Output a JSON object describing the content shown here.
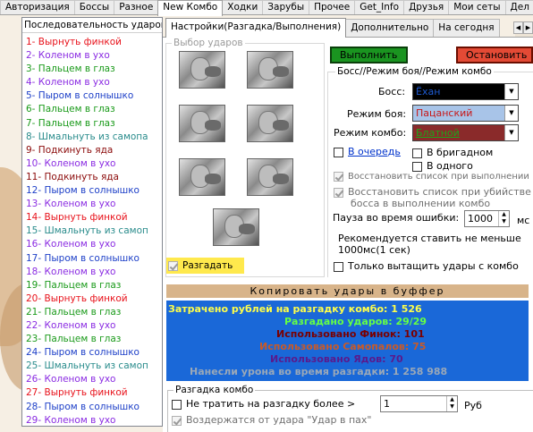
{
  "top_tabs": [
    "Авторизация",
    "Боссы",
    "Разное",
    "New Комбо",
    "Ходки",
    "Зарубы",
    "Прочее",
    "Get_Info",
    "Друзья",
    "Мои сеты",
    "Дел"
  ],
  "left_panel": {
    "title": "Последовательность ударов:",
    "items": [
      {
        "text": "1- Вырнуть финкой",
        "color": "#e8121b"
      },
      {
        "text": "2- Коленом в ухо",
        "color": "#8a2be2"
      },
      {
        "text": "3- Пальцем в глаз",
        "color": "#1a9a1a"
      },
      {
        "text": "4- Коленом в ухо",
        "color": "#8a2be2"
      },
      {
        "text": "5- Пыром в солнышко",
        "color": "#1e40c8"
      },
      {
        "text": "6- Пальцем в глаз",
        "color": "#1a9a1a"
      },
      {
        "text": "7- Пальцем в глаз",
        "color": "#1a9a1a"
      },
      {
        "text": "8- Шмальнуть из самопа",
        "color": "#2a8c8c"
      },
      {
        "text": "9- Подкинуть яда",
        "color": "#8b0a0a"
      },
      {
        "text": "10- Коленом в ухо",
        "color": "#8a2be2"
      },
      {
        "text": "11- Подкинуть яда",
        "color": "#8b0a0a"
      },
      {
        "text": "12- Пыром в солнышко",
        "color": "#1e40c8"
      },
      {
        "text": "13- Коленом в ухо",
        "color": "#8a2be2"
      },
      {
        "text": "14- Вырнуть финкой",
        "color": "#e8121b"
      },
      {
        "text": "15- Шмальнуть из самоп",
        "color": "#2a8c8c"
      },
      {
        "text": "16- Коленом в ухо",
        "color": "#8a2be2"
      },
      {
        "text": "17- Пыром в солнышко",
        "color": "#1e40c8"
      },
      {
        "text": "18- Коленом в ухо",
        "color": "#8a2be2"
      },
      {
        "text": "19- Пальцем в глаз",
        "color": "#1a9a1a"
      },
      {
        "text": "20- Вырнуть финкой",
        "color": "#e8121b"
      },
      {
        "text": "21- Пальцем в глаз",
        "color": "#1a9a1a"
      },
      {
        "text": "22- Коленом в ухо",
        "color": "#8a2be2"
      },
      {
        "text": "23- Пальцем в глаз",
        "color": "#1a9a1a"
      },
      {
        "text": "24- Пыром в солнышко",
        "color": "#1e40c8"
      },
      {
        "text": "25- Шмальнуть из самоп",
        "color": "#2a8c8c"
      },
      {
        "text": "26- Коленом в ухо",
        "color": "#8a2be2"
      },
      {
        "text": "27- Вырнуть финкой",
        "color": "#e8121b"
      },
      {
        "text": "28- Пыром в солнышко",
        "color": "#1e40c8"
      },
      {
        "text": "29- Коленом в ухо",
        "color": "#8a2be2"
      }
    ]
  },
  "inner_tabs": [
    "Настройки(Разгадка/Выполнения)",
    "Дополнительно",
    "На сегодня"
  ],
  "strike_group": {
    "title": "Выбор ударов",
    "guess_label": "Разгадать"
  },
  "buttons": {
    "run": "Выполнить",
    "stop": "Остановить"
  },
  "mode": {
    "title": "Босс//Режим боя//Режим комбо",
    "boss_label": "Босс:",
    "boss_value": "Ёхан",
    "fight_label": "Режим боя:",
    "fight_value": "Пацанский",
    "combo_label": "Режим комбо:",
    "combo_value": "Блатной",
    "queue_link": "В очередь",
    "brigade_label": "В бригадном",
    "single_label": "В одного",
    "restore_list": "Восстановить список при выполнении",
    "restore_kill_1": "Восстановить список при убийстве",
    "restore_kill_2": "босса в выполнении комбо",
    "pause_label": "Пауза во время ошибки:",
    "pause_value": "1000",
    "pause_unit": "мс",
    "recommend_1": "Рекомендуется ставить не меньше",
    "recommend_2": "1000мс(1 сек)",
    "only_pull": "Только вытащить удары с комбо"
  },
  "copy_bar": "Копировать удары в буффер",
  "stats": [
    {
      "text": "Затрачено рублей на разгадку комбо: 1 526",
      "color": "#ffff4a"
    },
    {
      "text": "Разгадано ударов: 29/29",
      "color": "#66ff44"
    },
    {
      "text": "Использовано Финок: 101",
      "color": "#7a0000"
    },
    {
      "text": "Использовано Самопалов: 75",
      "color": "#c85a28"
    },
    {
      "text": "Использовано Ядов: 70",
      "color": "#5a1a8c"
    },
    {
      "text": "Нанесли урона во время разгадки: 1 258 988",
      "color": "#9aa8b8"
    }
  ],
  "razgadka": {
    "title": "Разгадка комбо",
    "not_spend": "Не тратить на разгадку более >",
    "amount": "1",
    "currency": "Руб",
    "abstain": "Воздержатся от удара \"Удар в пах\""
  }
}
